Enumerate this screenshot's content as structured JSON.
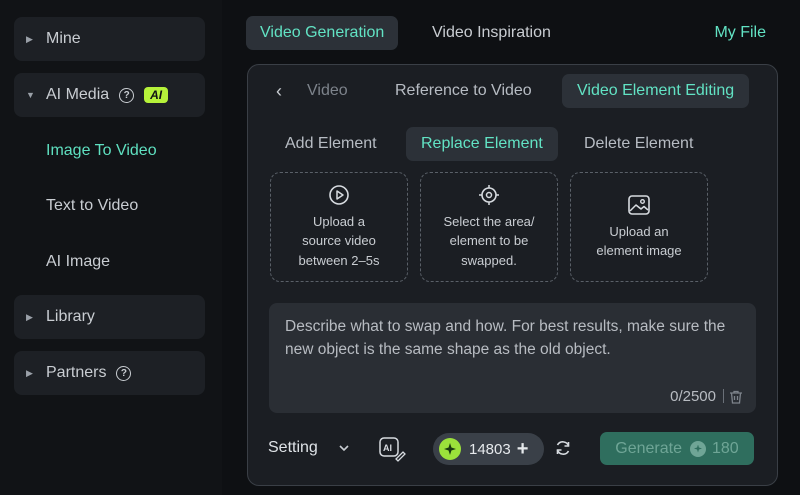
{
  "sidebar": {
    "mine": "Mine",
    "ai_media": "AI Media",
    "ai_badge": "AI",
    "sub_items": [
      "Image To Video",
      "Text to Video",
      "AI Image"
    ],
    "library": "Library",
    "partners": "Partners"
  },
  "top_tabs": {
    "video_generation": "Video Generation",
    "video_inspiration": "Video Inspiration",
    "my_file": "My File"
  },
  "panel": {
    "sub_tabs": {
      "video": "Video",
      "reference": "Reference to Video",
      "element_editing": "Video Element Editing"
    },
    "modes": {
      "add": "Add Element",
      "replace": "Replace Element",
      "delete": "Delete Element"
    },
    "cards": [
      "Upload a\nsource video\nbetween 2–5s",
      "Select the area/\nelement to be\nswapped.",
      "Upload an\nelement image"
    ],
    "prompt_placeholder": "Describe what to swap and how. For best results, make sure the new object is the same shape as the old object.",
    "counter": "0/2500",
    "setting": "Setting",
    "credits": "14803",
    "generate": "Generate",
    "generate_cost": "180"
  },
  "colors": {
    "accent": "#62e3c4",
    "ai_badge": "#b6f23a",
    "generate_bg": "#2f6e5e"
  }
}
